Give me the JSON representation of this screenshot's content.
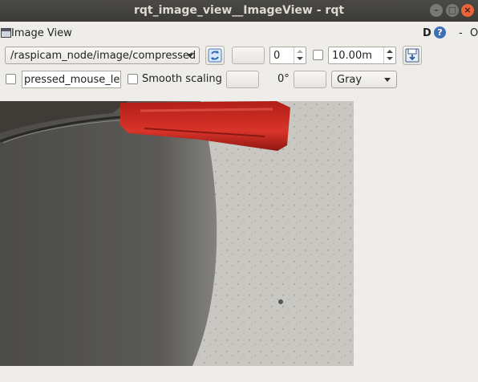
{
  "window": {
    "title": "rqt_image_view__ImageView - rqt",
    "minimize_icon": "minimize-icon",
    "maximize_icon": "maximize-icon",
    "close_icon": "close-icon"
  },
  "dock": {
    "title": "Image View",
    "d_label": "D",
    "help_glyph": "?",
    "dash_label": "-",
    "o_label": "O"
  },
  "toolbar": {
    "topic": "/raspicam_node/image/compressed",
    "blank_button_label": "",
    "spin_value": "0",
    "max_value": "10.00m",
    "refresh_icon": "refresh-icon",
    "save_icon": "save-icon"
  },
  "toolbar2": {
    "mouse_topic": "pressed_mouse_left",
    "smooth_label": "Smooth scaling",
    "rotation": "0°",
    "colormap": "Gray"
  },
  "colors": {
    "title_bg": "#3f3e3a",
    "window_bg": "#efedea",
    "close_button": "#e9643a",
    "help_icon": "#3b6fb6",
    "object_red": "#c8251c"
  }
}
